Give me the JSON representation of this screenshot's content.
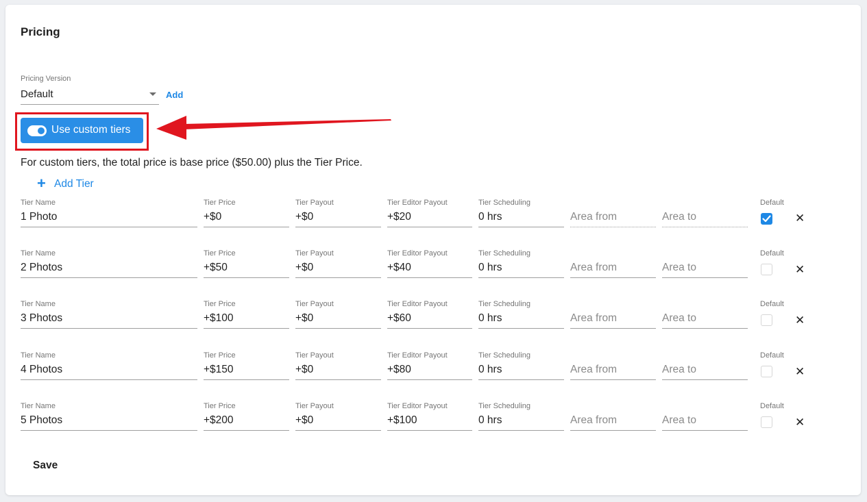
{
  "section": {
    "title": "Pricing"
  },
  "pricing_version": {
    "label": "Pricing Version",
    "value": "Default",
    "add_label": "Add"
  },
  "custom_tiers_toggle": {
    "label": "Use custom tiers",
    "on": true
  },
  "info_text": "For custom tiers, the total price is base price ($50.00) plus the Tier Price.",
  "add_tier_label": "Add Tier",
  "columns": {
    "tier_name": "Tier Name",
    "tier_price": "Tier Price",
    "tier_payout": "Tier Payout",
    "tier_editor_payout": "Tier Editor Payout",
    "tier_scheduling": "Tier Scheduling",
    "default": "Default"
  },
  "placeholders": {
    "area_from": "Area from",
    "area_to": "Area to"
  },
  "tiers": [
    {
      "name": "1 Photo",
      "price": "+$0",
      "payout": "+$0",
      "editor_payout": "+$20",
      "scheduling": "0 hrs",
      "default": true
    },
    {
      "name": "2 Photos",
      "price": "+$50",
      "payout": "+$0",
      "editor_payout": "+$40",
      "scheduling": "0 hrs",
      "default": false
    },
    {
      "name": "3 Photos",
      "price": "+$100",
      "payout": "+$0",
      "editor_payout": "+$60",
      "scheduling": "0 hrs",
      "default": false
    },
    {
      "name": "4 Photos",
      "price": "+$150",
      "payout": "+$0",
      "editor_payout": "+$80",
      "scheduling": "0 hrs",
      "default": false
    },
    {
      "name": "5 Photos",
      "price": "+$200",
      "payout": "+$0",
      "editor_payout": "+$100",
      "scheduling": "0 hrs",
      "default": false
    }
  ],
  "delete_icon": "close-icon",
  "save_label": "Save",
  "colors": {
    "accent": "#2a8ee6",
    "link": "#1e88e5",
    "annotation_red": "#e0161f"
  }
}
